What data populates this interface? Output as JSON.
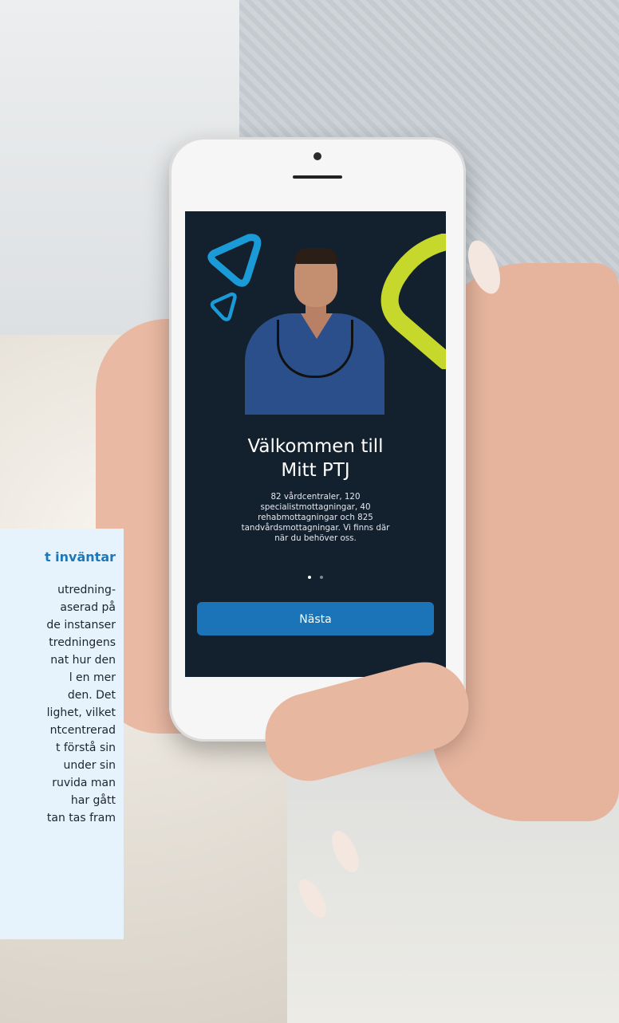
{
  "app_screen": {
    "title_line1": "Välkommen till",
    "title_line2": "Mitt PTJ",
    "description_lines": [
      "82 vårdcentraler, 120",
      "specialistmottagningar, 40",
      "rehabmottagningar och 825",
      "tandvårdsmottagningar. Vi finns där",
      "när du behöver oss."
    ],
    "pager": {
      "count": 2,
      "active": 0
    },
    "next_button_label": "Nästa"
  },
  "colors": {
    "screen_bg": "#13202e",
    "accent_blue": "#1b74b7",
    "triangle_blue": "#1a9ad6",
    "lime": "#c6d82b",
    "card_bg": "#e6f3fd",
    "card_title": "#1d77b8"
  },
  "icons": {
    "large_triangle": "rounded-triangle-outline-icon",
    "small_triangle": "rounded-triangle-outline-icon",
    "swoosh": "lime-swoosh-shape"
  },
  "side_card": {
    "title": "t inväntar",
    "lines": [
      "utredning-",
      "aserad på",
      "de instanser",
      "tredningens",
      "nat hur den",
      "l en mer",
      "den. Det",
      "lighet, vilket",
      "ntcentrerad",
      "t förstå sin",
      "under sin",
      "ruvida man",
      "har gått",
      "tan tas fram"
    ]
  }
}
